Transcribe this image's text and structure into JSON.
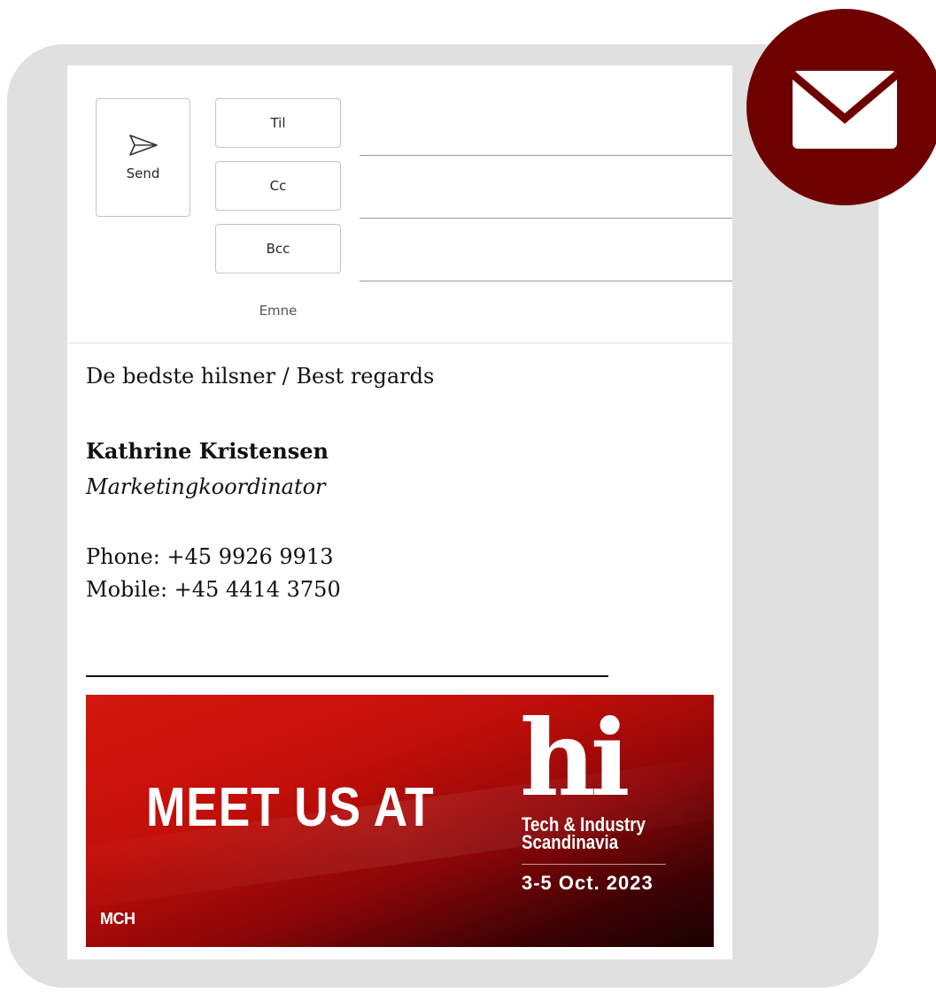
{
  "compose": {
    "send_label": "Send",
    "to_label": "Til",
    "cc_label": "Cc",
    "bcc_label": "Bcc",
    "subject_label": "Emne"
  },
  "message": {
    "greeting": "De bedste hilsner / Best regards",
    "name": "Kathrine Kristensen",
    "title": "Marketingkoordinator",
    "phone": "Phone: +45 9926 9913",
    "mobile": "Mobile: +45 4414 3750"
  },
  "banner": {
    "headline": "MEET US AT",
    "logo_text": "hi",
    "event_name_line1": "Tech & Industry",
    "event_name_line2": "Scandinavia",
    "event_date": "3-5 Oct. 2023",
    "company_logo_text": "MCH"
  },
  "icons": {
    "send": "send-arrow-icon",
    "mail_badge": "envelope-icon"
  },
  "colors": {
    "frame_background": "#dfe0df",
    "badge": "#6e0000",
    "banner_red": "#c20f09"
  }
}
